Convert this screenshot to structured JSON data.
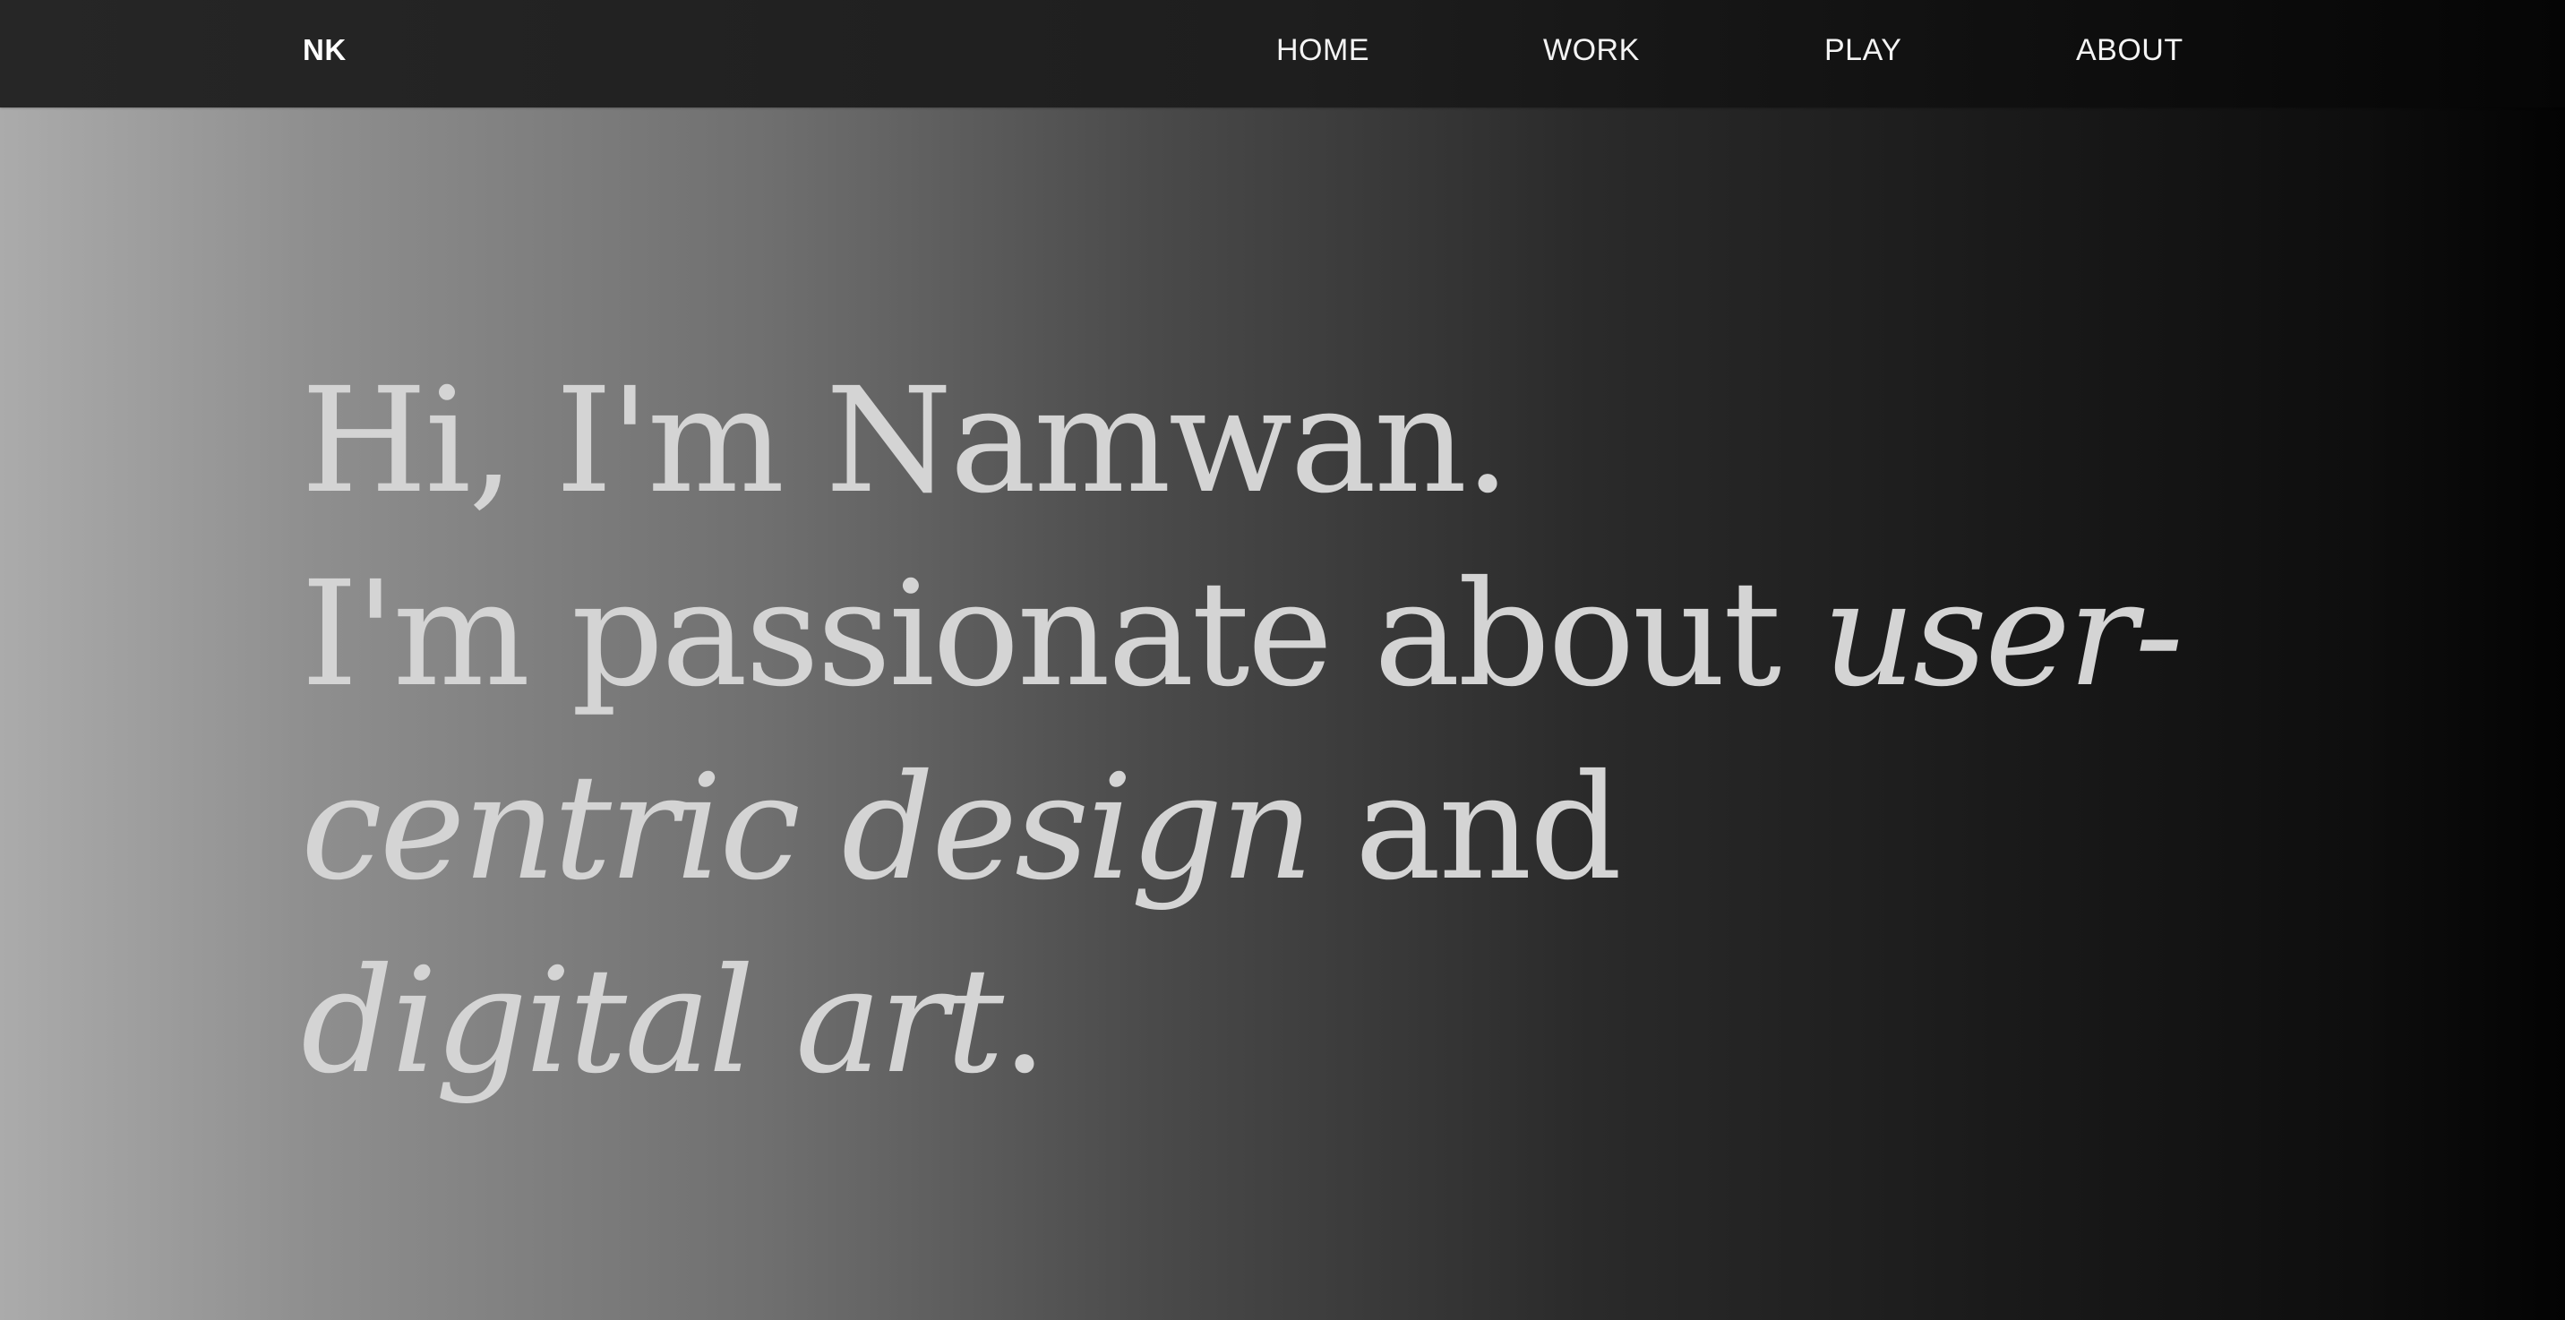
{
  "nav": {
    "logo": "NK",
    "links": [
      {
        "label": "HOME"
      },
      {
        "label": "WORK"
      },
      {
        "label": "PLAY"
      },
      {
        "label": "ABOUT"
      }
    ]
  },
  "hero": {
    "greeting": "Hi, I'm Namwan.",
    "intro": "I'm passionate about ",
    "emphasis_1a": "user-",
    "emphasis_1b": "centric design",
    "connector": " and",
    "emphasis_2": "digital art",
    "end_punct": "."
  },
  "colors": {
    "nav_background": "#1e1e1e",
    "nav_text": "#ffffff",
    "hero_text": "#d4d4d4",
    "background_left": "#ababab",
    "background_right": "#030303"
  }
}
